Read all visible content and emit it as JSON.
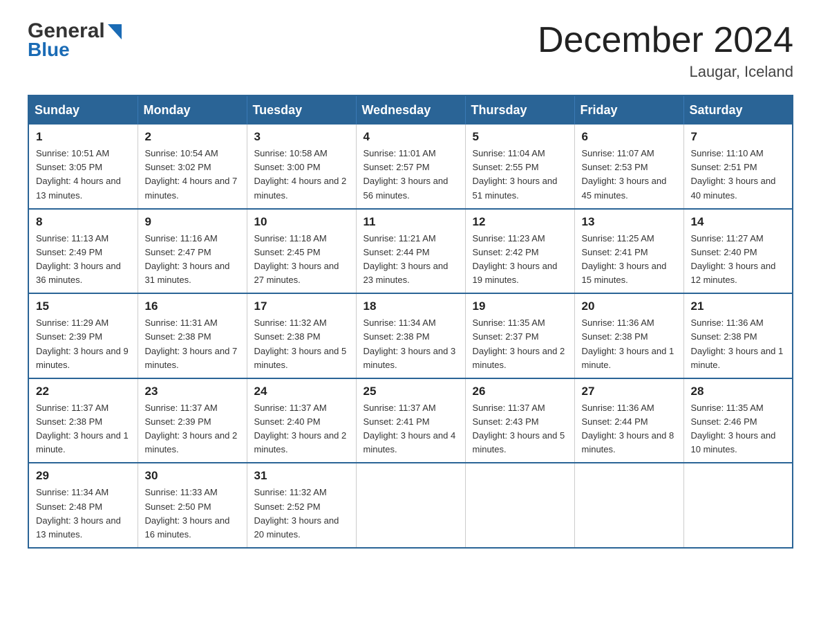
{
  "header": {
    "logo_general": "General",
    "logo_blue": "Blue",
    "month_title": "December 2024",
    "location": "Laugar, Iceland"
  },
  "days_of_week": [
    "Sunday",
    "Monday",
    "Tuesday",
    "Wednesday",
    "Thursday",
    "Friday",
    "Saturday"
  ],
  "weeks": [
    [
      {
        "day": "1",
        "sunrise": "Sunrise: 10:51 AM",
        "sunset": "Sunset: 3:05 PM",
        "daylight": "Daylight: 4 hours and 13 minutes."
      },
      {
        "day": "2",
        "sunrise": "Sunrise: 10:54 AM",
        "sunset": "Sunset: 3:02 PM",
        "daylight": "Daylight: 4 hours and 7 minutes."
      },
      {
        "day": "3",
        "sunrise": "Sunrise: 10:58 AM",
        "sunset": "Sunset: 3:00 PM",
        "daylight": "Daylight: 4 hours and 2 minutes."
      },
      {
        "day": "4",
        "sunrise": "Sunrise: 11:01 AM",
        "sunset": "Sunset: 2:57 PM",
        "daylight": "Daylight: 3 hours and 56 minutes."
      },
      {
        "day": "5",
        "sunrise": "Sunrise: 11:04 AM",
        "sunset": "Sunset: 2:55 PM",
        "daylight": "Daylight: 3 hours and 51 minutes."
      },
      {
        "day": "6",
        "sunrise": "Sunrise: 11:07 AM",
        "sunset": "Sunset: 2:53 PM",
        "daylight": "Daylight: 3 hours and 45 minutes."
      },
      {
        "day": "7",
        "sunrise": "Sunrise: 11:10 AM",
        "sunset": "Sunset: 2:51 PM",
        "daylight": "Daylight: 3 hours and 40 minutes."
      }
    ],
    [
      {
        "day": "8",
        "sunrise": "Sunrise: 11:13 AM",
        "sunset": "Sunset: 2:49 PM",
        "daylight": "Daylight: 3 hours and 36 minutes."
      },
      {
        "day": "9",
        "sunrise": "Sunrise: 11:16 AM",
        "sunset": "Sunset: 2:47 PM",
        "daylight": "Daylight: 3 hours and 31 minutes."
      },
      {
        "day": "10",
        "sunrise": "Sunrise: 11:18 AM",
        "sunset": "Sunset: 2:45 PM",
        "daylight": "Daylight: 3 hours and 27 minutes."
      },
      {
        "day": "11",
        "sunrise": "Sunrise: 11:21 AM",
        "sunset": "Sunset: 2:44 PM",
        "daylight": "Daylight: 3 hours and 23 minutes."
      },
      {
        "day": "12",
        "sunrise": "Sunrise: 11:23 AM",
        "sunset": "Sunset: 2:42 PM",
        "daylight": "Daylight: 3 hours and 19 minutes."
      },
      {
        "day": "13",
        "sunrise": "Sunrise: 11:25 AM",
        "sunset": "Sunset: 2:41 PM",
        "daylight": "Daylight: 3 hours and 15 minutes."
      },
      {
        "day": "14",
        "sunrise": "Sunrise: 11:27 AM",
        "sunset": "Sunset: 2:40 PM",
        "daylight": "Daylight: 3 hours and 12 minutes."
      }
    ],
    [
      {
        "day": "15",
        "sunrise": "Sunrise: 11:29 AM",
        "sunset": "Sunset: 2:39 PM",
        "daylight": "Daylight: 3 hours and 9 minutes."
      },
      {
        "day": "16",
        "sunrise": "Sunrise: 11:31 AM",
        "sunset": "Sunset: 2:38 PM",
        "daylight": "Daylight: 3 hours and 7 minutes."
      },
      {
        "day": "17",
        "sunrise": "Sunrise: 11:32 AM",
        "sunset": "Sunset: 2:38 PM",
        "daylight": "Daylight: 3 hours and 5 minutes."
      },
      {
        "day": "18",
        "sunrise": "Sunrise: 11:34 AM",
        "sunset": "Sunset: 2:38 PM",
        "daylight": "Daylight: 3 hours and 3 minutes."
      },
      {
        "day": "19",
        "sunrise": "Sunrise: 11:35 AM",
        "sunset": "Sunset: 2:37 PM",
        "daylight": "Daylight: 3 hours and 2 minutes."
      },
      {
        "day": "20",
        "sunrise": "Sunrise: 11:36 AM",
        "sunset": "Sunset: 2:38 PM",
        "daylight": "Daylight: 3 hours and 1 minute."
      },
      {
        "day": "21",
        "sunrise": "Sunrise: 11:36 AM",
        "sunset": "Sunset: 2:38 PM",
        "daylight": "Daylight: 3 hours and 1 minute."
      }
    ],
    [
      {
        "day": "22",
        "sunrise": "Sunrise: 11:37 AM",
        "sunset": "Sunset: 2:38 PM",
        "daylight": "Daylight: 3 hours and 1 minute."
      },
      {
        "day": "23",
        "sunrise": "Sunrise: 11:37 AM",
        "sunset": "Sunset: 2:39 PM",
        "daylight": "Daylight: 3 hours and 2 minutes."
      },
      {
        "day": "24",
        "sunrise": "Sunrise: 11:37 AM",
        "sunset": "Sunset: 2:40 PM",
        "daylight": "Daylight: 3 hours and 2 minutes."
      },
      {
        "day": "25",
        "sunrise": "Sunrise: 11:37 AM",
        "sunset": "Sunset: 2:41 PM",
        "daylight": "Daylight: 3 hours and 4 minutes."
      },
      {
        "day": "26",
        "sunrise": "Sunrise: 11:37 AM",
        "sunset": "Sunset: 2:43 PM",
        "daylight": "Daylight: 3 hours and 5 minutes."
      },
      {
        "day": "27",
        "sunrise": "Sunrise: 11:36 AM",
        "sunset": "Sunset: 2:44 PM",
        "daylight": "Daylight: 3 hours and 8 minutes."
      },
      {
        "day": "28",
        "sunrise": "Sunrise: 11:35 AM",
        "sunset": "Sunset: 2:46 PM",
        "daylight": "Daylight: 3 hours and 10 minutes."
      }
    ],
    [
      {
        "day": "29",
        "sunrise": "Sunrise: 11:34 AM",
        "sunset": "Sunset: 2:48 PM",
        "daylight": "Daylight: 3 hours and 13 minutes."
      },
      {
        "day": "30",
        "sunrise": "Sunrise: 11:33 AM",
        "sunset": "Sunset: 2:50 PM",
        "daylight": "Daylight: 3 hours and 16 minutes."
      },
      {
        "day": "31",
        "sunrise": "Sunrise: 11:32 AM",
        "sunset": "Sunset: 2:52 PM",
        "daylight": "Daylight: 3 hours and 20 minutes."
      },
      null,
      null,
      null,
      null
    ]
  ]
}
